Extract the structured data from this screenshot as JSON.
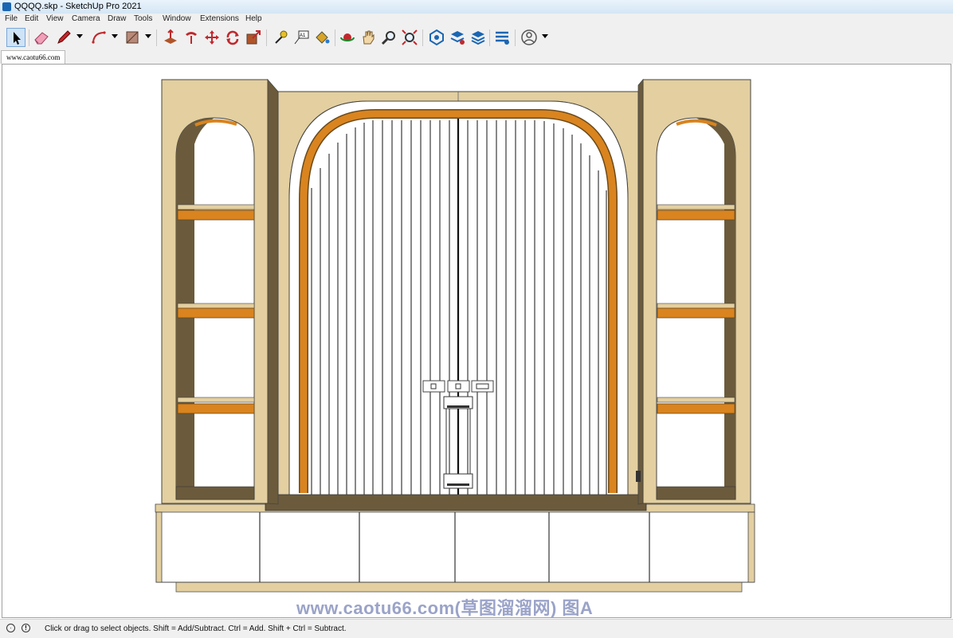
{
  "window": {
    "title": "QQQQ.skp - SketchUp Pro 2021"
  },
  "menu": {
    "items": [
      "File",
      "Edit",
      "View",
      "Camera",
      "Draw",
      "Tools",
      "Window",
      "Extensions",
      "Help"
    ]
  },
  "toolbar": {
    "icons": [
      "select-icon",
      "eraser-icon",
      "pencil-icon",
      "arc-icon",
      "rectangle-icon",
      "push-pull-icon",
      "follow-me-icon",
      "move-icon",
      "rotate-icon",
      "scale-icon",
      "tape-measure-icon",
      "text-icon",
      "paint-bucket-icon",
      "orbit-icon",
      "pan-icon",
      "zoom-icon",
      "zoom-extents-icon",
      "warehouse-icon",
      "extension-warehouse-icon",
      "layout-icon",
      "extension-manager-icon",
      "account-icon"
    ]
  },
  "scene_tab": {
    "label": "www.caotu66.com"
  },
  "watermark": {
    "text": "www.caotu66.com(草图溜溜网) 图A"
  },
  "status": {
    "text": "Click or drag to select objects. Shift = Add/Subtract. Ctrl = Add. Shift + Ctrl = Subtract."
  },
  "colors": {
    "wood": "#e3cfa0",
    "wood_dark": "#6b5b3c",
    "orange": "#d9841f",
    "accent": "#1a66b3"
  }
}
